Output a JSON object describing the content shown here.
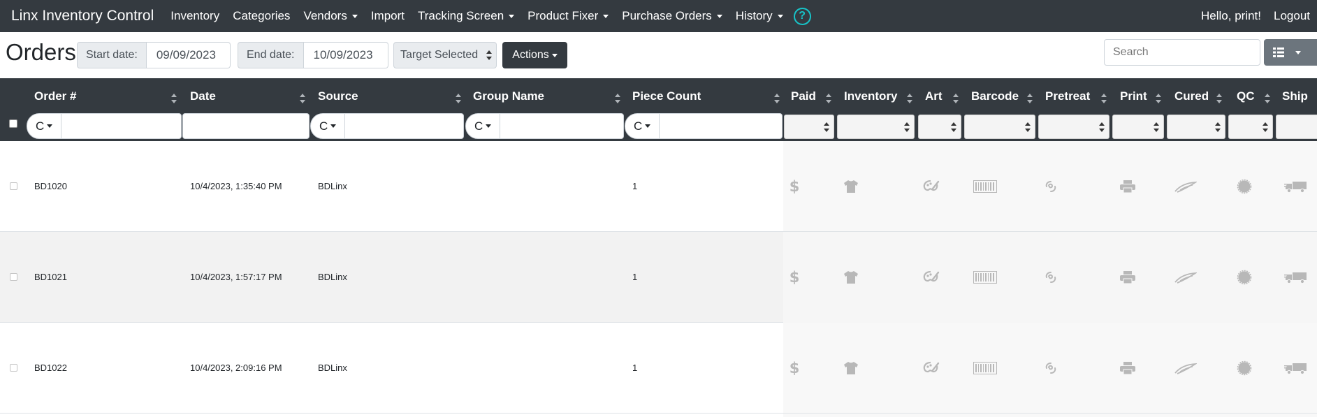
{
  "navbar": {
    "brand": "Linx Inventory Control",
    "links": [
      {
        "label": "Inventory",
        "dropdown": false
      },
      {
        "label": "Categories",
        "dropdown": false
      },
      {
        "label": "Vendors",
        "dropdown": true
      },
      {
        "label": "Import",
        "dropdown": false
      },
      {
        "label": "Tracking Screen",
        "dropdown": true
      },
      {
        "label": "Product Fixer",
        "dropdown": true
      },
      {
        "label": "Purchase Orders",
        "dropdown": true
      },
      {
        "label": "History",
        "dropdown": true
      }
    ],
    "help_symbol": "?",
    "greeting": "Hello, print!",
    "logout": "Logout"
  },
  "toolbar": {
    "title": "Orders",
    "start_label": "Start date:",
    "start_value": "09/09/2023",
    "end_label": "End date:",
    "end_value": "10/09/2023",
    "target_select": "Target Selected",
    "actions_label": "Actions",
    "search_placeholder": "Search"
  },
  "table": {
    "columns": [
      "Order #",
      "Date",
      "Source",
      "Group Name",
      "Piece Count",
      "Paid",
      "Inventory",
      "Art",
      "Barcode",
      "Pretreat",
      "Print",
      "Cured",
      "QC",
      "Ship"
    ],
    "filter_select_label": "C",
    "rows": [
      {
        "order": "BD1020",
        "date": "10/4/2023, 1:35:40 PM",
        "source": "BDLinx",
        "group": "",
        "pieces": "1"
      },
      {
        "order": "BD1021",
        "date": "10/4/2023, 1:57:17 PM",
        "source": "BDLinx",
        "group": "",
        "pieces": "1"
      },
      {
        "order": "BD1022",
        "date": "10/4/2023, 2:09:16 PM",
        "source": "BDLinx",
        "group": "",
        "pieces": "1"
      }
    ],
    "status_icons": [
      "dollar-icon",
      "tshirt-icon",
      "palette-icon",
      "barcode-icon",
      "spray-icon",
      "printer-icon",
      "heat-press-icon",
      "seal-icon",
      "truck-icon"
    ],
    "icon_color": "#b8b8b8"
  }
}
